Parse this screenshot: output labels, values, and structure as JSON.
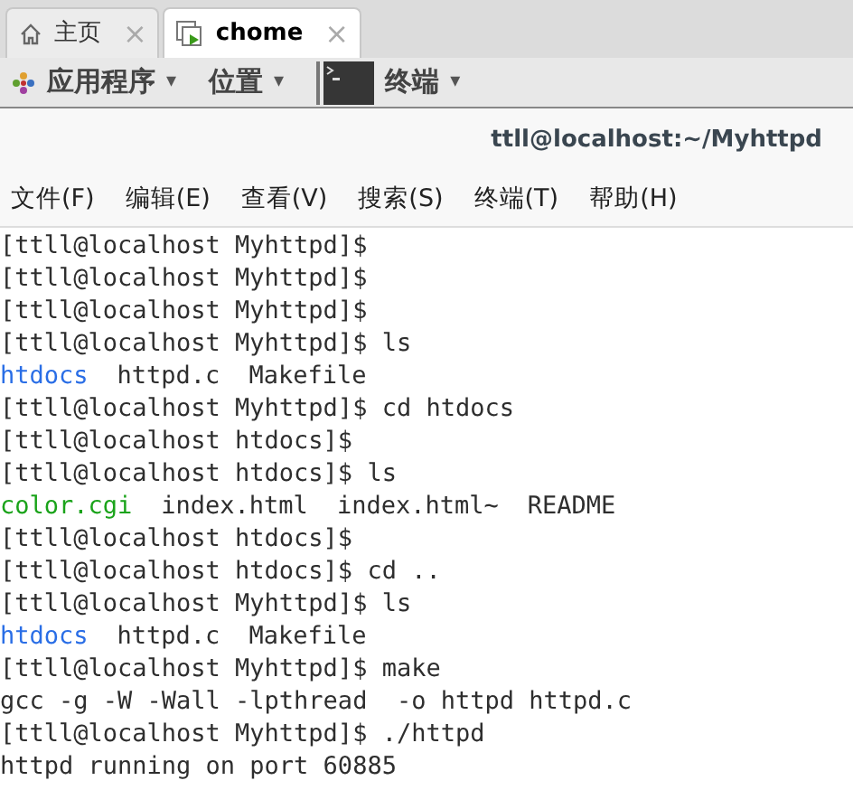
{
  "tabs": [
    {
      "label": "主页",
      "kind": "home",
      "selected": false,
      "close": "×"
    },
    {
      "label": "chome",
      "kind": "window",
      "selected": true,
      "close": "×"
    }
  ],
  "panel": {
    "menus": [
      {
        "label": "应用程序",
        "kind": "apps",
        "arrow": "▾"
      },
      {
        "label": "位置",
        "kind": "places",
        "arrow": "▾"
      },
      {
        "label": "终端",
        "kind": "terminal",
        "arrow": "▾"
      }
    ]
  },
  "window": {
    "title": "ttll@localhost:~/Myhttpd"
  },
  "menu_bar": [
    "文件(F)",
    "编辑(E)",
    "查看(V)",
    "搜索(S)",
    "终端(T)",
    "帮助(H)"
  ],
  "terminal": {
    "lines": [
      [
        {
          "text": "[ttll@localhost Myhttpd]$",
          "kind": "plain"
        }
      ],
      [
        {
          "text": "[ttll@localhost Myhttpd]$",
          "kind": "plain"
        }
      ],
      [
        {
          "text": "[ttll@localhost Myhttpd]$",
          "kind": "plain"
        }
      ],
      [
        {
          "text": "[ttll@localhost Myhttpd]$ ls",
          "kind": "plain"
        }
      ],
      [
        {
          "text": "htdocs",
          "kind": "dir"
        },
        {
          "text": "httpd.c",
          "kind": "plain"
        },
        {
          "text": "Makefile",
          "kind": "plain"
        }
      ],
      [
        {
          "text": "[ttll@localhost Myhttpd]$ cd htdocs",
          "kind": "plain"
        }
      ],
      [
        {
          "text": "[ttll@localhost htdocs]$",
          "kind": "plain"
        }
      ],
      [
        {
          "text": "[ttll@localhost htdocs]$ ls",
          "kind": "plain"
        }
      ],
      [
        {
          "text": "color.cgi",
          "kind": "exe"
        },
        {
          "text": "index.html",
          "kind": "plain"
        },
        {
          "text": "index.html~",
          "kind": "plain"
        },
        {
          "text": "README",
          "kind": "plain"
        }
      ],
      [
        {
          "text": "[ttll@localhost htdocs]$",
          "kind": "plain"
        }
      ],
      [
        {
          "text": "[ttll@localhost htdocs]$ cd ..",
          "kind": "plain"
        }
      ],
      [
        {
          "text": "[ttll@localhost Myhttpd]$ ls",
          "kind": "plain"
        }
      ],
      [
        {
          "text": "htdocs",
          "kind": "dir"
        },
        {
          "text": "httpd.c",
          "kind": "plain"
        },
        {
          "text": "Makefile",
          "kind": "plain"
        }
      ],
      [
        {
          "text": "[ttll@localhost Myhttpd]$ make",
          "kind": "plain"
        }
      ],
      [
        {
          "text": "gcc -g -W -Wall -lpthread  -o httpd httpd.c",
          "kind": "plain"
        }
      ],
      [
        {
          "text": "[ttll@localhost Myhttpd]$ ./httpd",
          "kind": "plain"
        }
      ],
      [
        {
          "text": "httpd running on port 60885",
          "kind": "plain"
        }
      ]
    ]
  }
}
